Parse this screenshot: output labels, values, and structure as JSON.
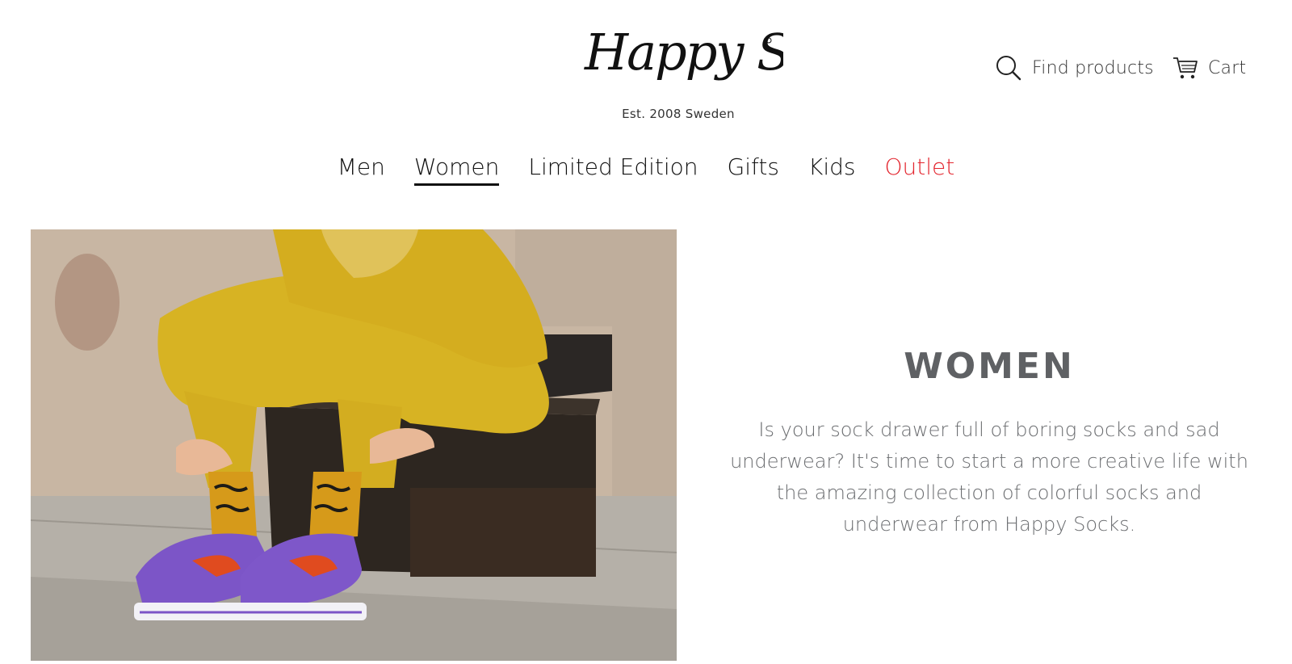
{
  "brand": {
    "logo_text": "Happy Socks",
    "tagline": "Est. 2008 Sweden"
  },
  "utility": {
    "search_label": "Find products",
    "search_icon": "search-icon",
    "cart_label": "Cart",
    "cart_icon": "cart-icon"
  },
  "nav": {
    "items": [
      {
        "label": "Men"
      },
      {
        "label": "Women",
        "active": true
      },
      {
        "label": "Limited Edition"
      },
      {
        "label": "Gifts"
      },
      {
        "label": "Kids"
      },
      {
        "label": "Outlet",
        "color": "#e3262f"
      }
    ]
  },
  "hero": {
    "image": "woman-yellow-outfit-patterned-socks-purple-sneakers"
  },
  "category": {
    "title": "WOMEN",
    "description": "Is your sock drawer full of boring socks and sad underwear? It's time to start a more creative life with the amazing collection of colorful socks and underwear from Happy Socks."
  },
  "colors": {
    "accent_outlet": "#e3262f",
    "title_gray": "#5f6164"
  }
}
